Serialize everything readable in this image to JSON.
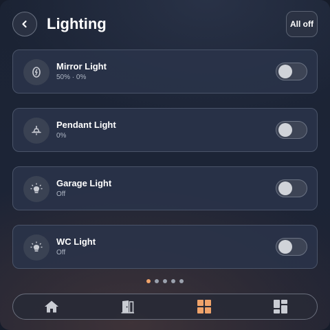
{
  "header": {
    "title": "Lighting",
    "back_icon": "chevron-left-icon",
    "all_off_label": "All off"
  },
  "lights": [
    {
      "name": "Mirror Light",
      "status": "50% · 0%",
      "icon": "mirror-light-icon",
      "on": false
    },
    {
      "name": "Pendant Light",
      "status": "0%",
      "icon": "pendant-lamp-icon",
      "on": false
    },
    {
      "name": "Garage Light",
      "status": "Off",
      "icon": "bulb-icon",
      "on": false
    },
    {
      "name": "WC Light",
      "status": "Off",
      "icon": "bulb-icon",
      "on": false
    }
  ],
  "pagination": {
    "count": 5,
    "active_index": 0
  },
  "bottom_nav": {
    "items": [
      {
        "icon": "home-icon",
        "active": false
      },
      {
        "icon": "room-door-icon",
        "active": false
      },
      {
        "icon": "grid-icon",
        "active": true
      },
      {
        "icon": "dashboard-icon",
        "active": false
      }
    ]
  },
  "colors": {
    "accent": "#f0a36a",
    "card_bg": "#2a344a",
    "icon_inactive": "#c9ccd3"
  }
}
